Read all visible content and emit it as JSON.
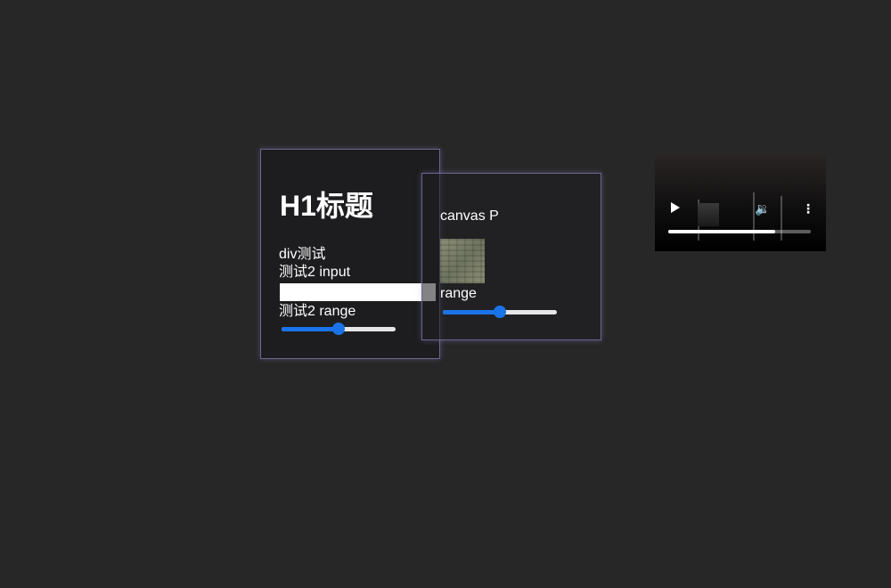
{
  "panel1": {
    "heading": "H1标题",
    "div_text": "div测试",
    "input_label": "测试2 input",
    "input_value": "",
    "range_label": "测试2 range",
    "range_value": 0.5
  },
  "panel2": {
    "canvas_label": "canvas P",
    "range_label": "range",
    "range_value": 0.5
  },
  "video": {
    "progress": 0.75,
    "icons": [
      "play-icon",
      "volume-icon",
      "more-vert-icon"
    ]
  },
  "colors": {
    "background": "#272727",
    "accent": "#1a73e8",
    "panel_border": "#6a6690"
  }
}
